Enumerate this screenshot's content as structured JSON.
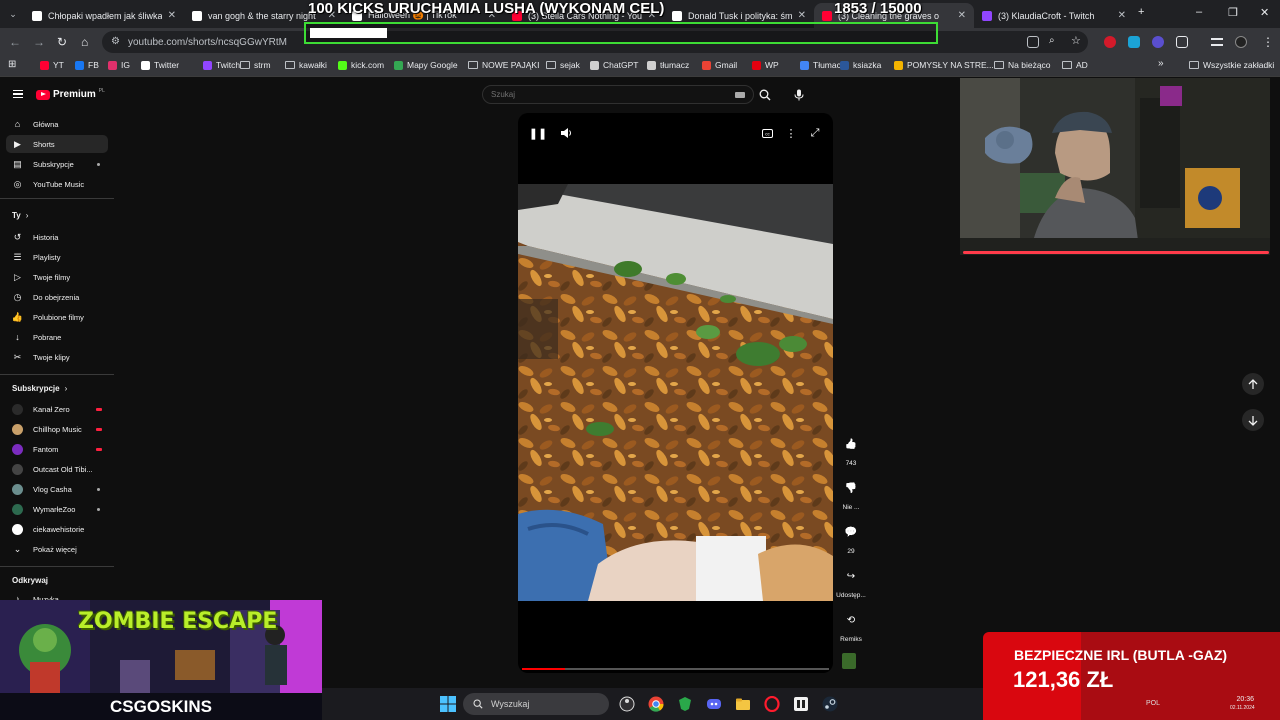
{
  "browser": {
    "tabs": [
      {
        "title": "Chłopaki wpadłem jak śliwka w",
        "favicon_color": "#ffffff",
        "active": false
      },
      {
        "title": "van gogh & the starry night",
        "favicon_color": "#ffffff",
        "active": false
      },
      {
        "title": "Halloween 🎃 | TikTok",
        "favicon_color": "#ffffff",
        "active": false
      },
      {
        "title": "(3) Stella Cars Nothing - You",
        "favicon_color": "#ff0033",
        "active": false
      },
      {
        "title": "Donald Tusk i polityka: śmiesz",
        "favicon_color": "#ffffff",
        "active": false
      },
      {
        "title": "(3) Cleaning the graves o",
        "favicon_color": "#ff0033",
        "active": true
      },
      {
        "title": "(3) KlaudiaCroft - Twitch",
        "favicon_color": "#9146ff",
        "active": false
      }
    ],
    "tab_close": "✕",
    "new_tab": "+",
    "window_controls": {
      "minimize": "–",
      "maximize": "❐",
      "close": "✕"
    },
    "url": "youtube.com/shorts/ncsqGGwYRtM",
    "bookmarks": [
      {
        "label": "YT",
        "kind": "site",
        "color": "#ff0033"
      },
      {
        "label": "FB",
        "kind": "site",
        "color": "#1877f2"
      },
      {
        "label": "IG",
        "kind": "site",
        "color": "#e1306c"
      },
      {
        "label": "Twitter",
        "kind": "site",
        "color": "#ffffff"
      },
      {
        "label": "Twitch",
        "kind": "site",
        "color": "#9146ff"
      },
      {
        "label": "strm",
        "kind": "folder"
      },
      {
        "label": "kawałki",
        "kind": "folder"
      },
      {
        "label": "kick.com",
        "kind": "site",
        "color": "#53fc18"
      },
      {
        "label": "Mapy Google",
        "kind": "site",
        "color": "#34a853"
      },
      {
        "label": "NOWE PAJĄKI",
        "kind": "folder"
      },
      {
        "label": "sejak",
        "kind": "folder"
      },
      {
        "label": "ChatGPT",
        "kind": "site",
        "color": "#d0d0d0"
      },
      {
        "label": "tłumacz",
        "kind": "site",
        "color": "#d0d0d0"
      },
      {
        "label": "Gmail",
        "kind": "site",
        "color": "#ea4335"
      },
      {
        "label": "WP",
        "kind": "site",
        "color": "#e3000f"
      },
      {
        "label": "Tłumacz",
        "kind": "site",
        "color": "#4285f4"
      },
      {
        "label": "ksiazka",
        "kind": "site",
        "color": "#2b579a"
      },
      {
        "label": "POMYSŁY NA STRE...",
        "kind": "site",
        "color": "#f4b400"
      },
      {
        "label": "Na bieżąco",
        "kind": "folder"
      },
      {
        "label": "AD",
        "kind": "folder"
      }
    ],
    "bookmarks_overflow": "»",
    "all_bookmarks": "Wszystkie zakładki"
  },
  "goal": {
    "title": "100 KICKS URUCHAMIA LUSHA (WYKONAM CEL)",
    "count": "1853 / 15000",
    "progress_fraction": 0.1235,
    "border_color": "#3ddc35"
  },
  "youtube": {
    "brand": "Premium",
    "brand_region": "PL",
    "search_placeholder": "Szukaj",
    "nav_main": [
      {
        "label": "Główna",
        "icon": "home-icon",
        "glyph": "⌂",
        "active": false
      },
      {
        "label": "Shorts",
        "icon": "shorts-icon",
        "glyph": "▶",
        "active": true
      },
      {
        "label": "Subskrypcje",
        "icon": "subscriptions-icon",
        "glyph": "▤",
        "active": false,
        "dot": true
      },
      {
        "label": "YouTube Music",
        "icon": "music-icon",
        "glyph": "◎",
        "active": false
      }
    ],
    "you_header": "Ty",
    "nav_you": [
      {
        "label": "Historia",
        "icon": "history-icon",
        "glyph": "↺"
      },
      {
        "label": "Playlisty",
        "icon": "playlist-icon",
        "glyph": "☰"
      },
      {
        "label": "Twoje filmy",
        "icon": "your-videos-icon",
        "glyph": "▷"
      },
      {
        "label": "Do obejrzenia",
        "icon": "watch-later-icon",
        "glyph": "◷"
      },
      {
        "label": "Polubione filmy",
        "icon": "liked-icon",
        "glyph": "👍"
      },
      {
        "label": "Pobrane",
        "icon": "download-icon",
        "glyph": "↓"
      },
      {
        "label": "Twoje klipy",
        "icon": "clips-icon",
        "glyph": "✂"
      }
    ],
    "subs_header": "Subskrypcje",
    "subscriptions": [
      {
        "label": "Kanał Zero",
        "color": "#2b2b2b",
        "live": true
      },
      {
        "label": "Chillhop Music",
        "color": "#c9a06a",
        "live": true
      },
      {
        "label": "Fantom",
        "color": "#7b2cbf",
        "live": true
      },
      {
        "label": "Outcast Old Tibi...",
        "color": "#444444",
        "live": true
      },
      {
        "label": "Vlog Casha",
        "color": "#6b8e8e",
        "dot": true
      },
      {
        "label": "WymarłeZoo",
        "color": "#2d6a4f",
        "dot": true
      },
      {
        "label": "ciekawehistorie",
        "color": "#ffffff",
        "dot": false
      },
      {
        "label": "Pokaż więcej",
        "color": "",
        "more": true
      }
    ],
    "explore_header": "Odkrywaj",
    "explore": [
      {
        "label": "Muzyka",
        "icon": "music-note-icon",
        "glyph": "♪"
      }
    ],
    "actions": [
      {
        "name": "like",
        "label": "743",
        "glyph": "👍"
      },
      {
        "name": "dislike",
        "label": "Nie ...",
        "glyph": "👎"
      },
      {
        "name": "comments",
        "label": "29",
        "glyph": "💬"
      },
      {
        "name": "share",
        "label": "Udostęp...",
        "glyph": "↪"
      },
      {
        "name": "remix",
        "label": "Remiks",
        "glyph": "⟲"
      }
    ],
    "video_progress_fraction": 0.14
  },
  "zombie": {
    "title": "ZOMBIE ESCAPE",
    "brand": "CSGOSKINS"
  },
  "donation": {
    "name": "BEZPIECZNE IRL (BUTLA -GAZ)",
    "amount": "121,36 ZŁ"
  },
  "taskbar": {
    "search_placeholder": "Wyszukaj",
    "tray_lang": "POL",
    "time": "20:36",
    "date": "02.11.2024"
  }
}
